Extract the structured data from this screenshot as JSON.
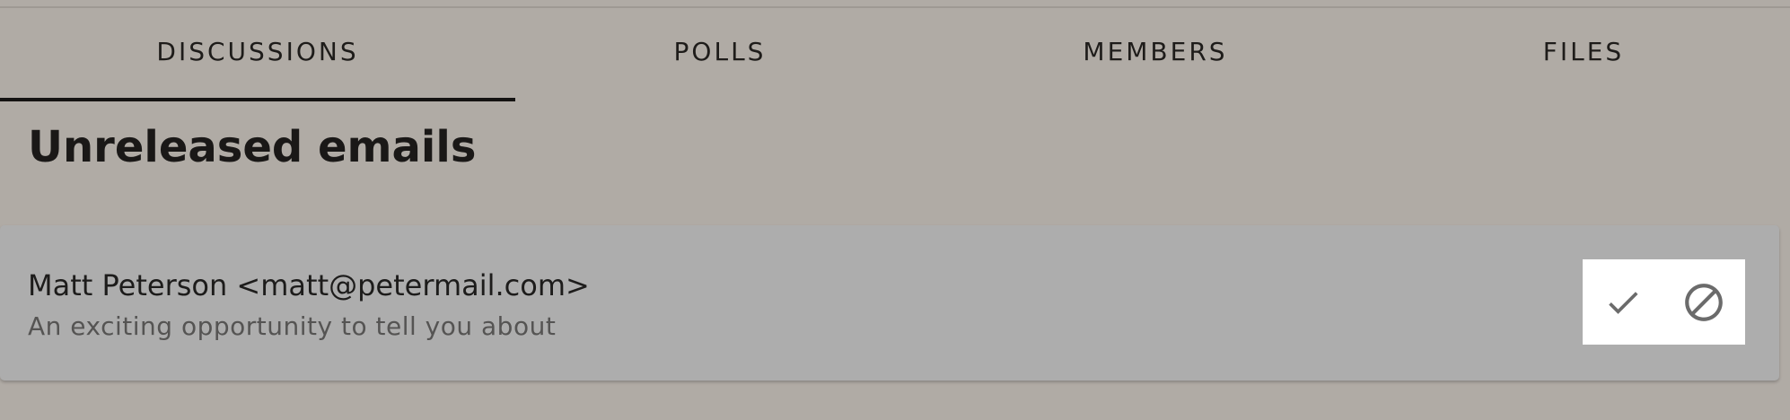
{
  "tabs": [
    {
      "label": "DISCUSSIONS",
      "active": true
    },
    {
      "label": "POLLS",
      "active": false
    },
    {
      "label": "MEMBERS",
      "active": false
    },
    {
      "label": "FILES",
      "active": false
    }
  ],
  "section": {
    "title": "Unreleased emails"
  },
  "emails": [
    {
      "sender": "Matt Peterson <matt@petermail.com>",
      "subject": "An exciting opportunity to tell you about",
      "actions": [
        {
          "icon": "check-icon",
          "purpose": "approve"
        },
        {
          "icon": "block-icon",
          "purpose": "reject"
        }
      ]
    }
  ],
  "colors": {
    "background": "#b0aba5",
    "card": "#adadad",
    "text": "#1d1c1b",
    "muted_text": "#555453",
    "icon": "#6b6b6b",
    "indicator": "#141312"
  }
}
